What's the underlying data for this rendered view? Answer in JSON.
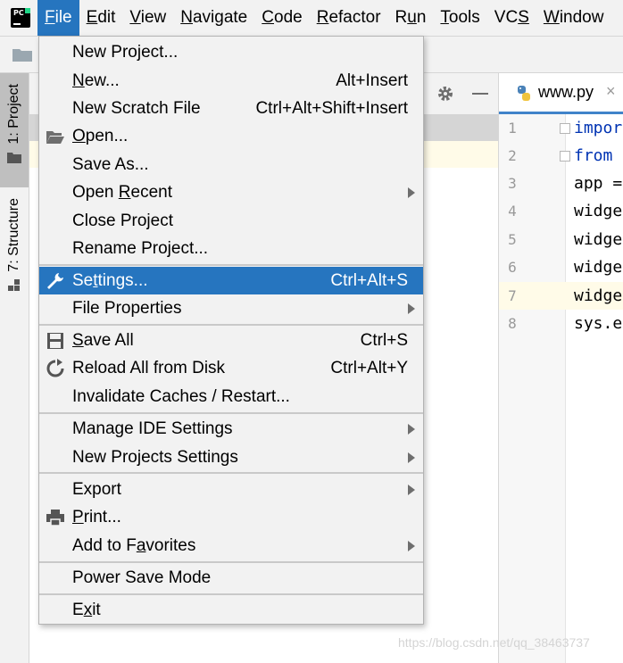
{
  "menubar": {
    "items": [
      {
        "pre": "",
        "u": "F",
        "post": "ile"
      },
      {
        "pre": "",
        "u": "E",
        "post": "dit"
      },
      {
        "pre": "",
        "u": "V",
        "post": "iew"
      },
      {
        "pre": "",
        "u": "N",
        "post": "avigate"
      },
      {
        "pre": "",
        "u": "C",
        "post": "ode"
      },
      {
        "pre": "",
        "u": "R",
        "post": "efactor"
      },
      {
        "pre": "R",
        "u": "u",
        "post": "n"
      },
      {
        "pre": "",
        "u": "T",
        "post": "ools"
      },
      {
        "pre": "VC",
        "u": "S",
        "post": ""
      },
      {
        "pre": "",
        "u": "W",
        "post": "indow"
      }
    ]
  },
  "left_strip": {
    "project_tab": "1: Project",
    "structure_tab": "7: Structure"
  },
  "editor": {
    "tab_label": "www.py",
    "tab_close": "×",
    "lines": [
      {
        "num": "1",
        "text": "import"
      },
      {
        "num": "2",
        "text": "from"
      },
      {
        "num": "3",
        "text": "app ="
      },
      {
        "num": "4",
        "text": "widget"
      },
      {
        "num": "5",
        "text": "widget"
      },
      {
        "num": "6",
        "text": "widget"
      },
      {
        "num": "7",
        "text": "widget"
      },
      {
        "num": "8",
        "text": "sys.e"
      }
    ]
  },
  "file_menu": {
    "new_project": "New Project...",
    "new": {
      "u": "N",
      "post": "ew...",
      "shortcut": "Alt+Insert"
    },
    "new_scratch": {
      "label": "New Scratch File",
      "shortcut": "Ctrl+Alt+Shift+Insert"
    },
    "open": {
      "u": "O",
      "post": "pen..."
    },
    "save_as": "Save As...",
    "open_recent": {
      "pre": "Open ",
      "u": "R",
      "post": "ecent"
    },
    "close_project": "Close Project",
    "rename_project": "Rename Project...",
    "settings": {
      "pre": "Se",
      "u": "t",
      "post": "tings...",
      "shortcut": "Ctrl+Alt+S"
    },
    "file_properties": "File Properties",
    "save_all": {
      "u": "S",
      "post": "ave All",
      "shortcut": "Ctrl+S"
    },
    "reload": {
      "label": "Reload All from Disk",
      "shortcut": "Ctrl+Alt+Y"
    },
    "invalidate": "Invalidate Caches / Restart...",
    "manage_ide": "Manage IDE Settings",
    "new_projects_settings": "New Projects Settings",
    "export": "Export",
    "print": {
      "u": "P",
      "post": "rint..."
    },
    "add_favorites": {
      "pre": "Add to F",
      "u": "a",
      "post": "vorites"
    },
    "power_save": "Power Save Mode",
    "exit": {
      "pre": "E",
      "u": "x",
      "post": "it"
    }
  },
  "watermark": "https://blog.csdn.net/qq_38463737",
  "colors": {
    "selection": "#2675bf",
    "keyword": "#0033b3",
    "tab_underline": "#4083c9"
  }
}
